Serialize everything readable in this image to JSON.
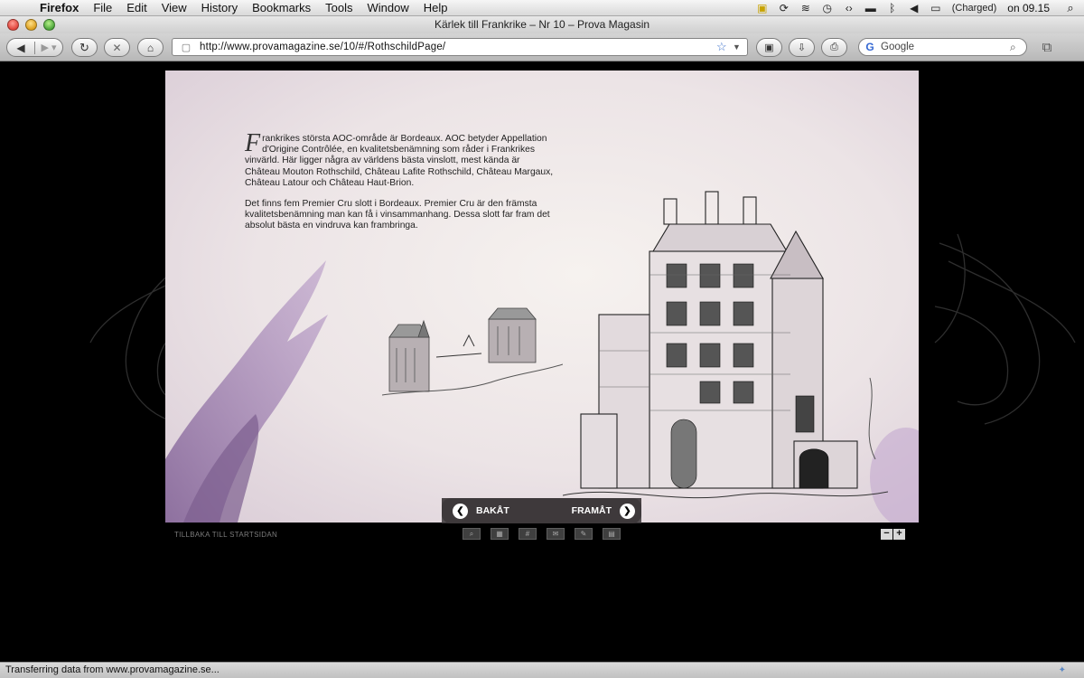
{
  "menubar": {
    "apple": "",
    "app": "Firefox",
    "menus": [
      "File",
      "Edit",
      "View",
      "History",
      "Bookmarks",
      "Tools",
      "Window",
      "Help"
    ],
    "battery": "(Charged)",
    "clock": "on 09.15"
  },
  "window": {
    "title": "Kärlek till Frankrike – Nr 10 – Prova Magasin"
  },
  "toolbar": {
    "url": "http://www.provamagazine.se/10/#/RothschildPage/",
    "search_placeholder": "Google"
  },
  "article": {
    "drop_cap": "F",
    "paragraph1": "rankrikes största AOC-område är Bordeaux. AOC betyder Appellation d'Origine Contrôlée, en kvalitetsbenämning som råder i Frankrikes vinvärld. Här ligger några av världens bästa vinslott, mest kända är Château Mouton Rothschild, Château Lafite Rothschild, Château Margaux, Château Latour och Château Haut-Brion.",
    "paragraph2": "Det finns fem Premier Cru slott i Bordeaux. Premier Cru är den främsta kvalitetsbenämning man kan få i vinsammanhang. Dessa slott far fram det absolut bästa en vindruva kan frambringa."
  },
  "nav": {
    "back": "BAKÅT",
    "forward": "FRAMÅT"
  },
  "footer": {
    "start_link": "TILLBAKA TILL STARTSIDAN",
    "zoom_out": "−",
    "zoom_in": "+"
  },
  "status": {
    "text": "Transferring data from www.provamagazine.se..."
  }
}
